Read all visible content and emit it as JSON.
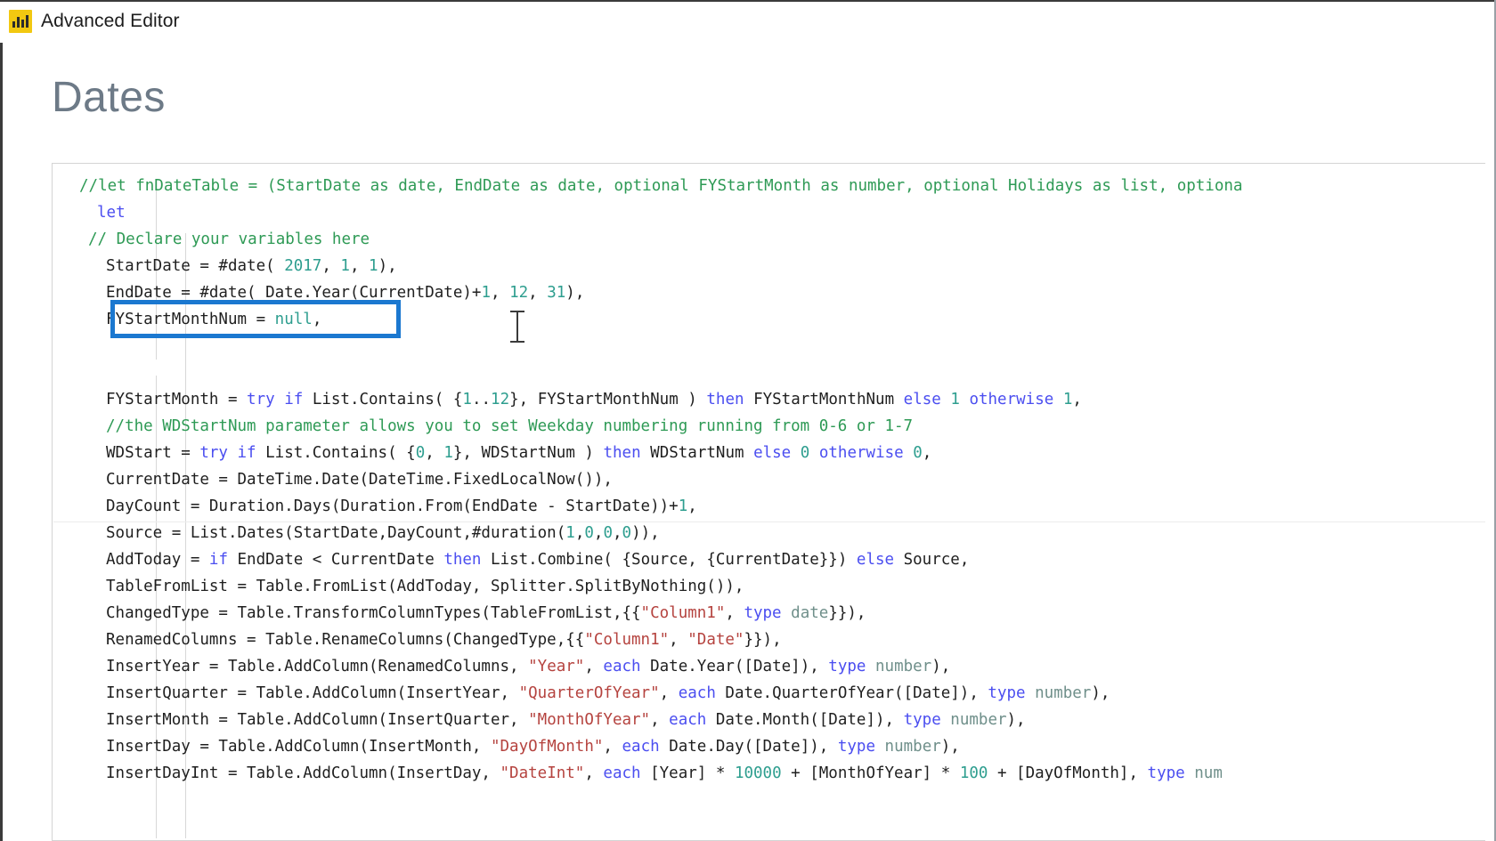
{
  "window": {
    "title": "Advanced Editor",
    "icon": "power-bi-bars-icon"
  },
  "heading": {
    "text": "Dates"
  },
  "annotation": {
    "type": "rectangle-highlight",
    "color": "#1b78d0",
    "target_line": "FYStartMonthNum = null,"
  },
  "cursor": {
    "type": "i-beam-text-cursor"
  },
  "colors": {
    "comment": "#2e9a55",
    "keyword": "#4b4ef0",
    "string": "#b5433f",
    "number": "#2e9e8f",
    "type": "#6f8f8a",
    "identifier": "#1f1f1f",
    "accent_yellow": "#f2c811",
    "annotation_blue": "#1b78d0",
    "heading": "#6d7a87"
  },
  "editor": {
    "language": "M (Power Query)",
    "lines": [
      {
        "id": "l01",
        "indent": 0,
        "segments": [
          {
            "t": "//let fnDateTable = (StartDate as date, EndDate as date, optional FYStartMonth as number, optional Holidays as list, optiona",
            "c": "cmt"
          }
        ]
      },
      {
        "id": "l02",
        "indent": 2,
        "segments": [
          {
            "t": "let",
            "c": "kw"
          }
        ]
      },
      {
        "id": "l03",
        "indent": 1,
        "segments": [
          {
            "t": "// Declare your variables here",
            "c": "cmt"
          }
        ]
      },
      {
        "id": "l04",
        "indent": 3,
        "segments": [
          {
            "t": "StartDate = #date( ",
            "c": "idn"
          },
          {
            "t": "2017",
            "c": "num"
          },
          {
            "t": ", ",
            "c": "idn"
          },
          {
            "t": "1",
            "c": "num"
          },
          {
            "t": ", ",
            "c": "idn"
          },
          {
            "t": "1",
            "c": "num"
          },
          {
            "t": "),",
            "c": "idn"
          }
        ]
      },
      {
        "id": "l05",
        "indent": 3,
        "segments": [
          {
            "t": "EndDate = #date( Date.Year(CurrentDate)+",
            "c": "idn"
          },
          {
            "t": "1",
            "c": "num"
          },
          {
            "t": ", ",
            "c": "idn"
          },
          {
            "t": "12",
            "c": "num"
          },
          {
            "t": ", ",
            "c": "idn"
          },
          {
            "t": "31",
            "c": "num"
          },
          {
            "t": "),",
            "c": "idn"
          }
        ]
      },
      {
        "id": "l06",
        "indent": 3,
        "segments": [
          {
            "t": "FYStartMonthNum = ",
            "c": "idn"
          },
          {
            "t": "null",
            "c": "num"
          },
          {
            "t": ",",
            "c": "idn"
          }
        ]
      },
      {
        "id": "l07",
        "indent": 0,
        "segments": [
          {
            "t": "",
            "c": "idn"
          }
        ]
      },
      {
        "id": "l08",
        "indent": 0,
        "segments": [
          {
            "t": "",
            "c": "idn"
          }
        ]
      },
      {
        "id": "l09",
        "indent": 3,
        "segments": [
          {
            "t": "FYStartMonth = ",
            "c": "idn"
          },
          {
            "t": "try",
            "c": "kw"
          },
          {
            "t": " ",
            "c": "idn"
          },
          {
            "t": "if",
            "c": "kw"
          },
          {
            "t": " List.Contains( {",
            "c": "idn"
          },
          {
            "t": "1",
            "c": "num"
          },
          {
            "t": "..",
            "c": "idn"
          },
          {
            "t": "12",
            "c": "num"
          },
          {
            "t": "}, FYStartMonthNum ) ",
            "c": "idn"
          },
          {
            "t": "then",
            "c": "kw"
          },
          {
            "t": " FYStartMonthNum ",
            "c": "idn"
          },
          {
            "t": "else",
            "c": "kw"
          },
          {
            "t": " ",
            "c": "idn"
          },
          {
            "t": "1",
            "c": "num"
          },
          {
            "t": " ",
            "c": "idn"
          },
          {
            "t": "otherwise",
            "c": "kw"
          },
          {
            "t": " ",
            "c": "idn"
          },
          {
            "t": "1",
            "c": "num"
          },
          {
            "t": ",",
            "c": "idn"
          }
        ]
      },
      {
        "id": "l10",
        "indent": 3,
        "segments": [
          {
            "t": "//the WDStartNum parameter allows you to set Weekday numbering running from 0-6 or 1-7",
            "c": "cmt"
          }
        ]
      },
      {
        "id": "l11",
        "indent": 3,
        "segments": [
          {
            "t": "WDStart = ",
            "c": "idn"
          },
          {
            "t": "try",
            "c": "kw"
          },
          {
            "t": " ",
            "c": "idn"
          },
          {
            "t": "if",
            "c": "kw"
          },
          {
            "t": " List.Contains( {",
            "c": "idn"
          },
          {
            "t": "0",
            "c": "num"
          },
          {
            "t": ", ",
            "c": "idn"
          },
          {
            "t": "1",
            "c": "num"
          },
          {
            "t": "}, WDStartNum ) ",
            "c": "idn"
          },
          {
            "t": "then",
            "c": "kw"
          },
          {
            "t": " WDStartNum ",
            "c": "idn"
          },
          {
            "t": "else",
            "c": "kw"
          },
          {
            "t": " ",
            "c": "idn"
          },
          {
            "t": "0",
            "c": "num"
          },
          {
            "t": " ",
            "c": "idn"
          },
          {
            "t": "otherwise",
            "c": "kw"
          },
          {
            "t": " ",
            "c": "idn"
          },
          {
            "t": "0",
            "c": "num"
          },
          {
            "t": ",",
            "c": "idn"
          }
        ]
      },
      {
        "id": "l12",
        "indent": 3,
        "segments": [
          {
            "t": "CurrentDate = DateTime.Date(DateTime.FixedLocalNow()),",
            "c": "idn"
          }
        ]
      },
      {
        "id": "l13",
        "indent": 3,
        "segments": [
          {
            "t": "DayCount = Duration.Days(Duration.From(EndDate - StartDate))+",
            "c": "idn"
          },
          {
            "t": "1",
            "c": "num"
          },
          {
            "t": ",",
            "c": "idn"
          }
        ]
      },
      {
        "id": "l14",
        "indent": 3,
        "segments": [
          {
            "t": "Source = List.Dates(StartDate,DayCount,#duration(",
            "c": "idn"
          },
          {
            "t": "1",
            "c": "num"
          },
          {
            "t": ",",
            "c": "idn"
          },
          {
            "t": "0",
            "c": "num"
          },
          {
            "t": ",",
            "c": "idn"
          },
          {
            "t": "0",
            "c": "num"
          },
          {
            "t": ",",
            "c": "idn"
          },
          {
            "t": "0",
            "c": "num"
          },
          {
            "t": ")),",
            "c": "idn"
          }
        ]
      },
      {
        "id": "l15",
        "indent": 3,
        "segments": [
          {
            "t": "AddToday = ",
            "c": "idn"
          },
          {
            "t": "if",
            "c": "kw"
          },
          {
            "t": " EndDate < CurrentDate ",
            "c": "idn"
          },
          {
            "t": "then",
            "c": "kw"
          },
          {
            "t": " List.Combine( {Source, {CurrentDate}}) ",
            "c": "idn"
          },
          {
            "t": "else",
            "c": "kw"
          },
          {
            "t": " Source,",
            "c": "idn"
          }
        ]
      },
      {
        "id": "l16",
        "indent": 3,
        "segments": [
          {
            "t": "TableFromList = Table.FromList(AddToday, Splitter.SplitByNothing()),",
            "c": "idn"
          }
        ]
      },
      {
        "id": "l17",
        "indent": 3,
        "segments": [
          {
            "t": "ChangedType = Table.TransformColumnTypes(TableFromList,{{",
            "c": "idn"
          },
          {
            "t": "\"Column1\"",
            "c": "str"
          },
          {
            "t": ", ",
            "c": "idn"
          },
          {
            "t": "type",
            "c": "kw"
          },
          {
            "t": " ",
            "c": "idn"
          },
          {
            "t": "date",
            "c": "typ"
          },
          {
            "t": "}}),",
            "c": "idn"
          }
        ]
      },
      {
        "id": "l18",
        "indent": 3,
        "segments": [
          {
            "t": "RenamedColumns = Table.RenameColumns(ChangedType,{{",
            "c": "idn"
          },
          {
            "t": "\"Column1\"",
            "c": "str"
          },
          {
            "t": ", ",
            "c": "idn"
          },
          {
            "t": "\"Date\"",
            "c": "str"
          },
          {
            "t": "}}),",
            "c": "idn"
          }
        ]
      },
      {
        "id": "l19",
        "indent": 3,
        "segments": [
          {
            "t": "InsertYear = Table.AddColumn(RenamedColumns, ",
            "c": "idn"
          },
          {
            "t": "\"Year\"",
            "c": "str"
          },
          {
            "t": ", ",
            "c": "idn"
          },
          {
            "t": "each",
            "c": "kw"
          },
          {
            "t": " Date.Year([Date]), ",
            "c": "idn"
          },
          {
            "t": "type",
            "c": "kw"
          },
          {
            "t": " ",
            "c": "idn"
          },
          {
            "t": "number",
            "c": "typ"
          },
          {
            "t": "),",
            "c": "idn"
          }
        ]
      },
      {
        "id": "l20",
        "indent": 3,
        "segments": [
          {
            "t": "InsertQuarter = Table.AddColumn(InsertYear, ",
            "c": "idn"
          },
          {
            "t": "\"QuarterOfYear\"",
            "c": "str"
          },
          {
            "t": ", ",
            "c": "idn"
          },
          {
            "t": "each",
            "c": "kw"
          },
          {
            "t": " Date.QuarterOfYear([Date]), ",
            "c": "idn"
          },
          {
            "t": "type",
            "c": "kw"
          },
          {
            "t": " ",
            "c": "idn"
          },
          {
            "t": "number",
            "c": "typ"
          },
          {
            "t": "),",
            "c": "idn"
          }
        ]
      },
      {
        "id": "l21",
        "indent": 3,
        "segments": [
          {
            "t": "InsertMonth = Table.AddColumn(InsertQuarter, ",
            "c": "idn"
          },
          {
            "t": "\"MonthOfYear\"",
            "c": "str"
          },
          {
            "t": ", ",
            "c": "idn"
          },
          {
            "t": "each",
            "c": "kw"
          },
          {
            "t": " Date.Month([Date]), ",
            "c": "idn"
          },
          {
            "t": "type",
            "c": "kw"
          },
          {
            "t": " ",
            "c": "idn"
          },
          {
            "t": "number",
            "c": "typ"
          },
          {
            "t": "),",
            "c": "idn"
          }
        ]
      },
      {
        "id": "l22",
        "indent": 3,
        "segments": [
          {
            "t": "InsertDay = Table.AddColumn(InsertMonth, ",
            "c": "idn"
          },
          {
            "t": "\"DayOfMonth\"",
            "c": "str"
          },
          {
            "t": ", ",
            "c": "idn"
          },
          {
            "t": "each",
            "c": "kw"
          },
          {
            "t": " Date.Day([Date]), ",
            "c": "idn"
          },
          {
            "t": "type",
            "c": "kw"
          },
          {
            "t": " ",
            "c": "idn"
          },
          {
            "t": "number",
            "c": "typ"
          },
          {
            "t": "),",
            "c": "idn"
          }
        ]
      },
      {
        "id": "l23",
        "indent": 3,
        "segments": [
          {
            "t": "InsertDayInt = Table.AddColumn(InsertDay, ",
            "c": "idn"
          },
          {
            "t": "\"DateInt\"",
            "c": "str"
          },
          {
            "t": ", ",
            "c": "idn"
          },
          {
            "t": "each",
            "c": "kw"
          },
          {
            "t": " [Year] * ",
            "c": "idn"
          },
          {
            "t": "10000",
            "c": "num"
          },
          {
            "t": " + [MonthOfYear] * ",
            "c": "idn"
          },
          {
            "t": "100",
            "c": "num"
          },
          {
            "t": " + [DayOfMonth], ",
            "c": "idn"
          },
          {
            "t": "type",
            "c": "kw"
          },
          {
            "t": " ",
            "c": "idn"
          },
          {
            "t": "num",
            "c": "typ"
          }
        ]
      }
    ]
  }
}
